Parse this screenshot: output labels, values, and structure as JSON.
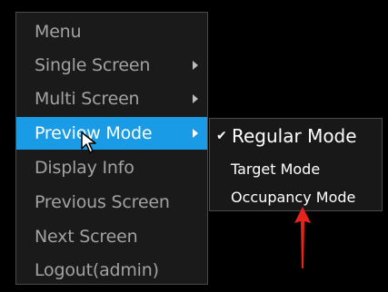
{
  "menu": {
    "items": [
      {
        "label": "Menu",
        "has_submenu": false,
        "active": false
      },
      {
        "label": "Single Screen",
        "has_submenu": true,
        "active": false
      },
      {
        "label": "Multi Screen",
        "has_submenu": true,
        "active": false
      },
      {
        "label": "Preview Mode",
        "has_submenu": true,
        "active": true
      },
      {
        "label": "Display Info",
        "has_submenu": false,
        "active": false
      },
      {
        "label": "Previous Screen",
        "has_submenu": false,
        "active": false
      },
      {
        "label": "Next Screen",
        "has_submenu": false,
        "active": false
      },
      {
        "label": "Logout(admin)",
        "has_submenu": false,
        "active": false
      }
    ]
  },
  "submenu": {
    "items": [
      {
        "label": "Regular Mode",
        "checked": true
      },
      {
        "label": "Target Mode",
        "checked": false
      },
      {
        "label": "Occupancy Mode",
        "checked": false
      }
    ],
    "check_glyph": "✔"
  },
  "annotation": {
    "arrow_color": "#e8231b",
    "icon": "red-arrow-up-icon"
  },
  "colors": {
    "highlight": "#1a9be6",
    "menu_text": "#a2a2a2",
    "background": "#000000"
  },
  "cursor_icon": "mouse-pointer-icon"
}
